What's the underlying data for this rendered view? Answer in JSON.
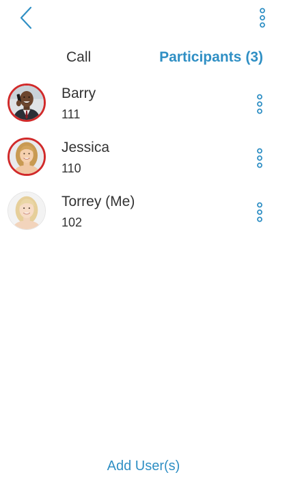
{
  "colors": {
    "accent": "#2f8fc4",
    "text": "#333333",
    "active_ring": "#d12a2a",
    "background": "#ffffff"
  },
  "header": {
    "back_icon": "chevron-left-icon",
    "menu_icon": "vertical-dots-icon"
  },
  "tabs": {
    "call_label": "Call",
    "participants_label": "Participants",
    "participants_count": "(3)"
  },
  "participants": [
    {
      "name": "Barry",
      "extension": "111",
      "avatar": "avatar-barry",
      "active_ring": true,
      "menu_icon": "vertical-dots-icon"
    },
    {
      "name": "Jessica",
      "extension": "110",
      "avatar": "avatar-jessica",
      "active_ring": true,
      "menu_icon": "vertical-dots-icon"
    },
    {
      "name": "Torrey (Me)",
      "extension": "102",
      "avatar": "avatar-torrey",
      "active_ring": false,
      "menu_icon": "vertical-dots-icon"
    }
  ],
  "footer": {
    "add_users_label": "Add User(s)"
  }
}
